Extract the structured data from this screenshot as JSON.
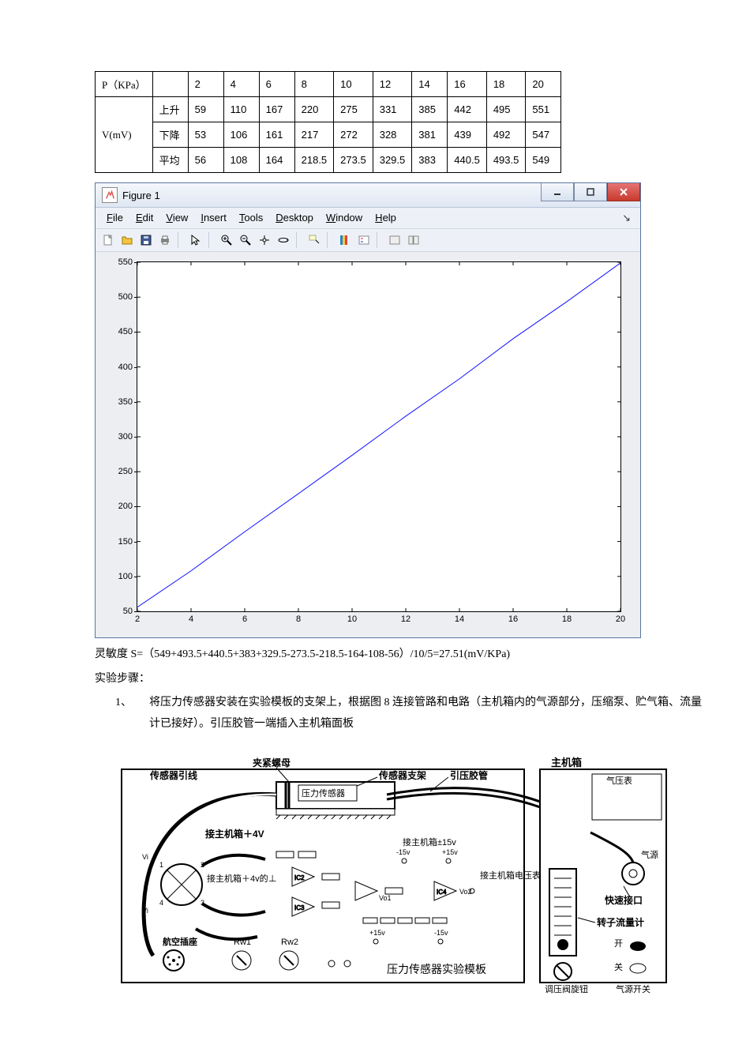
{
  "table": {
    "row_p_label": "P（KPa）",
    "row_v_label": "V(mV)",
    "sub_up": "上升",
    "sub_down": "下降",
    "sub_avg": "平均",
    "p": [
      "2",
      "4",
      "6",
      "8",
      "10",
      "12",
      "14",
      "16",
      "18",
      "20"
    ],
    "up": [
      "59",
      "110",
      "167",
      "220",
      "275",
      "331",
      "385",
      "442",
      "495",
      "551"
    ],
    "dn": [
      "53",
      "106",
      "161",
      "217",
      "272",
      "328",
      "381",
      "439",
      "492",
      "547"
    ],
    "avg": [
      "56",
      "108",
      "164",
      "218.5",
      "273.5",
      "329.5",
      "383",
      "440.5",
      "493.5",
      "549"
    ]
  },
  "figure": {
    "title": "Figure 1",
    "menu": {
      "file": "File",
      "edit": "Edit",
      "view": "View",
      "insert": "Insert",
      "tools": "Tools",
      "desktop": "Desktop",
      "window": "Window",
      "help": "Help"
    }
  },
  "chart_data": {
    "type": "line",
    "x": [
      2,
      4,
      6,
      8,
      10,
      12,
      14,
      16,
      18,
      20
    ],
    "y": [
      56,
      108,
      164,
      218.5,
      273.5,
      329.5,
      383,
      440.5,
      493.5,
      549
    ],
    "xlim": [
      2,
      20
    ],
    "ylim": [
      50,
      550
    ],
    "xticks": [
      2,
      4,
      6,
      8,
      10,
      12,
      14,
      16,
      18,
      20
    ],
    "yticks": [
      50,
      100,
      150,
      200,
      250,
      300,
      350,
      400,
      450,
      500,
      550
    ],
    "series_color": "#1010ff",
    "xlabel": "",
    "ylabel": "",
    "title": ""
  },
  "text": {
    "sensitivity": "灵敏度 S=（549+493.5+440.5+383+329.5-273.5-218.5-164-108-56）/10/5=27.51(mV/KPa)",
    "steps_title": "实验步骤：",
    "step1_num": "1、",
    "step1_body": "将压力传感器安装在实验模板的支架上，根据图 8 连接管路和电路（主机箱内的气源部分，压缩泵、贮气箱、流量计已接好）。引压胶管一端插入主机箱面板"
  },
  "diagram": {
    "sensor_lead": "传感器引线",
    "clamp_nut": "夹紧螺母",
    "sensor_bracket": "传感器支架",
    "pressure_tube": "引压胶管",
    "pressure_sensor": "压力传感器",
    "host_4v": "接主机箱＋4V",
    "host_15v": "接主机箱±15v",
    "to_host_4v_gnd": "接主机箱＋4v的⊥",
    "to_host_voltmeter": "接主机箱电压表",
    "air_socket": "航空插座",
    "rw1": "Rw1",
    "rw2": "Rw2",
    "board_title": "压力传感器实验模板",
    "host_box": "主机箱",
    "air_gauge": "气压表",
    "air_source": "气源",
    "quick_port": "快速接口",
    "rotor_flow": "转子流量计",
    "on": "开",
    "off": "关",
    "valve_knob": "调压阀旋钮",
    "air_switch": "气源开关",
    "m15v": "-15v",
    "p15v": "+15v",
    "m15v2": "-15v",
    "p15v2": "+15v",
    "vo1": "Vo1",
    "vo2": "Vo2",
    "ic2": "IC2",
    "ic3": "IC3",
    "ic4": "IC4",
    "vi1": "Vi",
    "vi2": "Vi",
    "n1": "1",
    "n2": "2",
    "n3": "3",
    "n4": "4"
  }
}
